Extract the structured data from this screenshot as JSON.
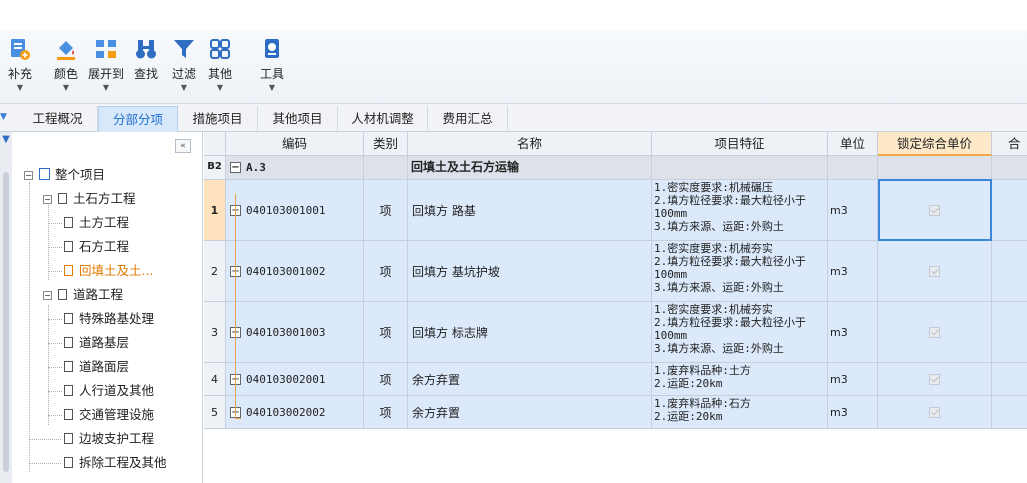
{
  "toolbar": {
    "buttons": [
      {
        "label": "补充",
        "icon": "supplement-icon"
      },
      {
        "label": "颜色",
        "icon": "color-bucket-icon"
      },
      {
        "label": "展开到",
        "icon": "expand-to-icon"
      },
      {
        "label": "查找",
        "icon": "binoculars-icon"
      },
      {
        "label": "过滤",
        "icon": "filter-icon"
      },
      {
        "label": "其他",
        "icon": "grid-icon"
      },
      {
        "label": "工具",
        "icon": "tools-icon"
      }
    ]
  },
  "tabs": [
    "工程概况",
    "分部分项",
    "措施项目",
    "其他项目",
    "人材机调整",
    "费用汇总"
  ],
  "active_tab": "分部分项",
  "tree": {
    "root": "整个项目",
    "nodes": [
      {
        "label": "土石方工程",
        "level": 1,
        "expandable": true
      },
      {
        "label": "土方工程",
        "level": 2
      },
      {
        "label": "石方工程",
        "level": 2
      },
      {
        "label": "回填土及土...",
        "level": 2,
        "selected": true
      },
      {
        "label": "道路工程",
        "level": 1,
        "expandable": true
      },
      {
        "label": "特殊路基处理",
        "level": 2
      },
      {
        "label": "道路基层",
        "level": 2
      },
      {
        "label": "道路面层",
        "level": 2
      },
      {
        "label": "人行道及其他",
        "level": 2
      },
      {
        "label": "交通管理设施",
        "level": 2
      },
      {
        "label": "边坡支护工程",
        "level": 1
      },
      {
        "label": "拆除工程及其他",
        "level": 1
      }
    ]
  },
  "grid": {
    "headers": [
      "编码",
      "类别",
      "名称",
      "项目特征",
      "单位",
      "锁定综合单价",
      "合同"
    ],
    "section": {
      "row_label": "B2",
      "code": "A.3",
      "name": "回填土及土石方运输"
    },
    "rows": [
      {
        "num": "1",
        "code": "040103001001",
        "type": "项",
        "name": "回填方 路基",
        "features": [
          "1.密实度要求:机械碾压",
          "2.填方粒径要求:最大粒径小于",
          "100mm",
          "3.填方来源、运距:外购土"
        ],
        "unit": "m3"
      },
      {
        "num": "2",
        "code": "040103001002",
        "type": "项",
        "name": "回填方 基坑护坡",
        "features": [
          "1.密实度要求:机械夯实",
          "2.填方粒径要求:最大粒径小于",
          "100mm",
          "3.填方来源、运距:外购土"
        ],
        "unit": "m3"
      },
      {
        "num": "3",
        "code": "040103001003",
        "type": "项",
        "name": "回填方 标志牌",
        "features": [
          "1.密实度要求:机械夯实",
          "2.填方粒径要求:最大粒径小于",
          "100mm",
          "3.填方来源、运距:外购土"
        ],
        "unit": "m3"
      },
      {
        "num": "4",
        "code": "040103002001",
        "type": "项",
        "name": "余方弃置",
        "features": [
          "1.废弃料品种:土方",
          "2.运距:20km"
        ],
        "unit": "m3"
      },
      {
        "num": "5",
        "code": "040103002002",
        "type": "项",
        "name": "余方弃置",
        "features": [
          "1.废弃料品种:石方",
          "2.运距:20km"
        ],
        "unit": "m3"
      }
    ]
  }
}
